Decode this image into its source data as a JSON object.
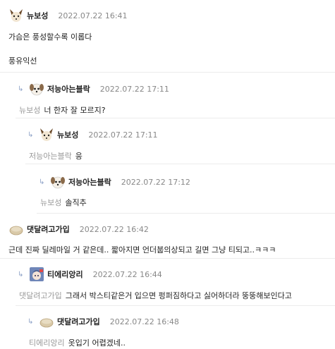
{
  "comments": [
    {
      "nick": "뉴보성",
      "date": "2022.07.22 16:41",
      "mention": "",
      "lines": [
        "가슴은 풍성할수록 이롭다",
        "",
        "풍유익선"
      ],
      "avatar": "fox-face-icon"
    },
    {
      "nick": "저능아는블락",
      "date": "2022.07.22 17:11",
      "mention": "뉴보성",
      "lines": [
        "너 한자 잘 모르지?"
      ],
      "avatar": "dog-face-icon"
    },
    {
      "nick": "뉴보성",
      "date": "2022.07.22 17:11",
      "mention": "저능아는블락",
      "lines": [
        "응"
      ],
      "avatar": "fox-face-icon"
    },
    {
      "nick": "저능아는블락",
      "date": "2022.07.22 17:12",
      "mention": "뉴보성",
      "lines": [
        "솔직추"
      ],
      "avatar": "dog-face-icon"
    },
    {
      "nick": "댓달려고가입",
      "date": "2022.07.22 16:42",
      "mention": "",
      "lines": [
        "근데 진짜 딜레마일 거 같은데.. 짧아지면 언더붑의상되고 길면 그냥 티되고..ㅋㅋㅋ"
      ],
      "avatar": "bread-icon"
    },
    {
      "nick": "티에리앙리",
      "date": "2022.07.22 16:44",
      "mention": "댓달려고가입",
      "lines": [
        "그래서 박스티같은거 입으면 펑퍼짐하다고 싫어하더라 뚱뚱해보인다고"
      ],
      "avatar": "anime-avatar-icon"
    },
    {
      "nick": "댓달려고가입",
      "date": "2022.07.22 16:48",
      "mention": "티에리앙리",
      "lines": [
        "옷입기 어렵겠네.."
      ],
      "avatar": "bread-icon"
    }
  ]
}
